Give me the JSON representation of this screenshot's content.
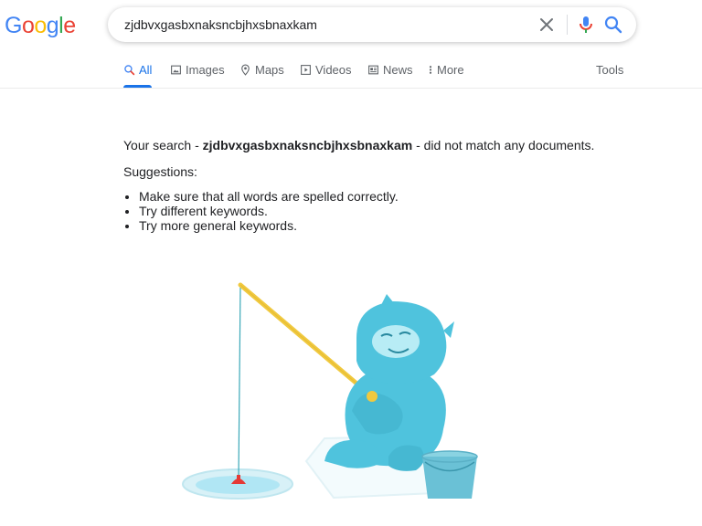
{
  "logo": {
    "letters": [
      "G",
      "o",
      "o",
      "g",
      "l",
      "e"
    ]
  },
  "search": {
    "query": "zjdbvxgasbxnaksncbjhxsbnaxkam"
  },
  "tabs": [
    {
      "label": "All",
      "icon": "search-icon"
    },
    {
      "label": "Images",
      "icon": "image-icon"
    },
    {
      "label": "Maps",
      "icon": "map-pin-icon"
    },
    {
      "label": "Videos",
      "icon": "video-icon"
    },
    {
      "label": "News",
      "icon": "news-icon"
    },
    {
      "label": "More",
      "icon": "more-vert-icon"
    }
  ],
  "tools_label": "Tools",
  "result": {
    "prefix": "Your search - ",
    "query": "zjdbvxgasbxnaksncbjhxsbnaxkam",
    "suffix": " - did not match any documents.",
    "suggestions_title": "Suggestions:",
    "suggestions": [
      "Make sure that all words are spelled correctly.",
      "Try different keywords.",
      "Try more general keywords."
    ]
  },
  "colors": {
    "blue": "#4285F4",
    "red": "#EA4335",
    "yellow": "#FBBC05",
    "green": "#34A853",
    "accent": "#1a73e8",
    "yeti": "#4fc3dd"
  }
}
